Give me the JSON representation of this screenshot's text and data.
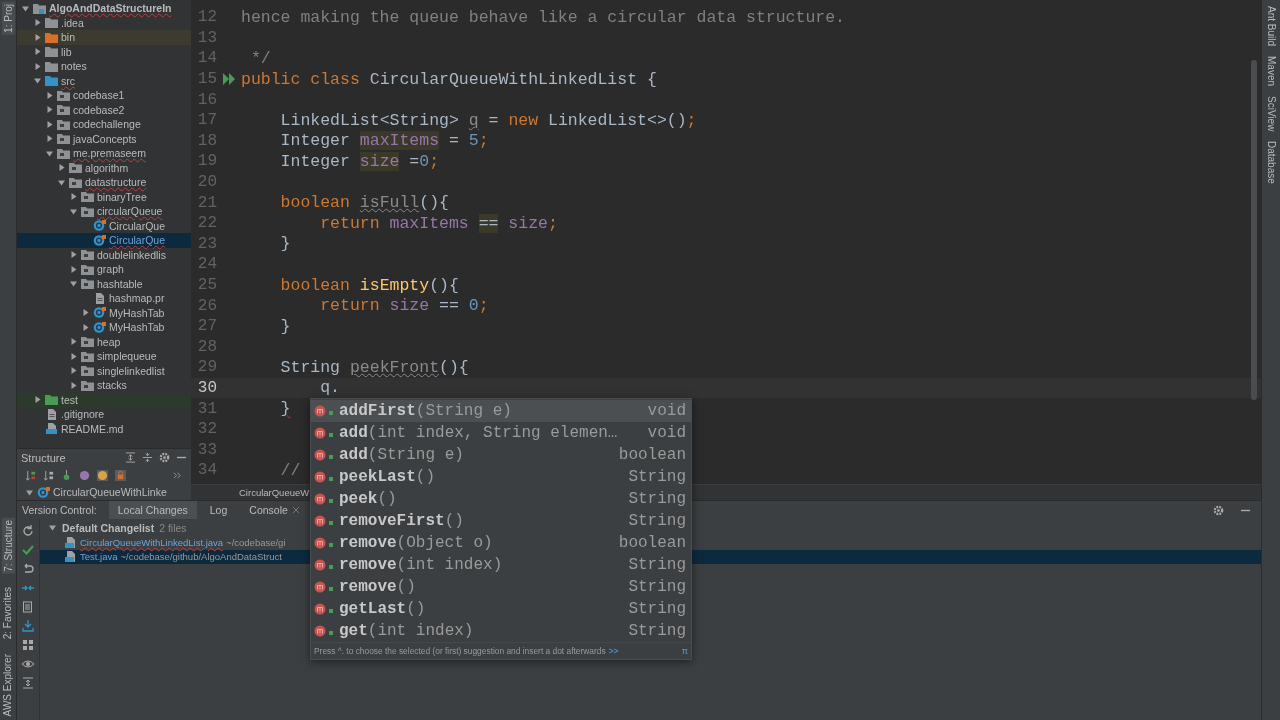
{
  "left_strip": {
    "top_tab": {
      "label": "1: Proj",
      "selected": true
    },
    "bottom_tabs": [
      {
        "label": "7: Structure",
        "selected": true
      },
      {
        "label": "2: Favorites",
        "selected": false
      },
      {
        "label": "AWS Explorer",
        "selected": false
      }
    ]
  },
  "project_tree": {
    "items": [
      {
        "label": "AlgoAndDataStructureIn",
        "kind": "project",
        "expanded": true,
        "selected": false,
        "errors": true,
        "children": [
          {
            "label": ".idea",
            "kind": "folder",
            "expanded": false,
            "selected": false,
            "errors": false
          },
          {
            "label": "bin",
            "kind": "folder_excluded",
            "expanded": false,
            "selected": false,
            "errors": false
          },
          {
            "label": "lib",
            "kind": "folder",
            "expanded": false,
            "selected": false,
            "errors": false
          },
          {
            "label": "notes",
            "kind": "folder",
            "expanded": false,
            "selected": false,
            "errors": false
          },
          {
            "label": "src",
            "kind": "folder_source",
            "expanded": true,
            "selected": false,
            "errors": true,
            "children": [
              {
                "label": "codebase1",
                "kind": "package",
                "expanded": false,
                "selected": false,
                "errors": false
              },
              {
                "label": "codebase2",
                "kind": "package",
                "expanded": false,
                "selected": false,
                "errors": false
              },
              {
                "label": "codechallenge",
                "kind": "package",
                "expanded": false,
                "selected": false,
                "errors": false
              },
              {
                "label": "javaConcepts",
                "kind": "package",
                "expanded": false,
                "selected": false,
                "errors": false
              },
              {
                "label": "me.premaseem",
                "kind": "package",
                "expanded": true,
                "selected": false,
                "errors": true,
                "children": [
                  {
                    "label": "algorithm",
                    "kind": "package",
                    "expanded": false,
                    "selected": false,
                    "errors": false
                  },
                  {
                    "label": "datastructure",
                    "kind": "package",
                    "expanded": true,
                    "selected": false,
                    "errors": true,
                    "children": [
                      {
                        "label": "binaryTree",
                        "kind": "package",
                        "expanded": false,
                        "selected": false,
                        "errors": false
                      },
                      {
                        "label": "circularQueue",
                        "kind": "package",
                        "expanded": true,
                        "selected": false,
                        "errors": true,
                        "children": [
                          {
                            "label": "CircularQue",
                            "kind": "class",
                            "selected": false,
                            "errors": false
                          },
                          {
                            "label": "CircularQue",
                            "kind": "class",
                            "selected": true,
                            "errors": true
                          }
                        ]
                      },
                      {
                        "label": "doublelinkedlis",
                        "kind": "package",
                        "expanded": false,
                        "selected": false,
                        "errors": false
                      },
                      {
                        "label": "graph",
                        "kind": "package",
                        "expanded": false,
                        "selected": false,
                        "errors": false
                      },
                      {
                        "label": "hashtable",
                        "kind": "package",
                        "expanded": true,
                        "selected": false,
                        "errors": false,
                        "children": [
                          {
                            "label": "hashmap.pr",
                            "kind": "file",
                            "selected": false,
                            "errors": false
                          },
                          {
                            "label": "MyHashTab",
                            "kind": "class",
                            "expanded": false,
                            "selected": false,
                            "errors": false
                          },
                          {
                            "label": "MyHashTab",
                            "kind": "class",
                            "expanded": false,
                            "selected": false,
                            "errors": false
                          }
                        ]
                      },
                      {
                        "label": "heap",
                        "kind": "package",
                        "expanded": false,
                        "selected": false,
                        "errors": false
                      },
                      {
                        "label": "simplequeue",
                        "kind": "package",
                        "expanded": false,
                        "selected": false,
                        "errors": false
                      },
                      {
                        "label": "singlelinkedlist",
                        "kind": "package",
                        "expanded": false,
                        "selected": false,
                        "errors": false
                      },
                      {
                        "label": "stacks",
                        "kind": "package",
                        "expanded": false,
                        "selected": false,
                        "errors": false
                      }
                    ]
                  }
                ]
              }
            ]
          },
          {
            "label": "test",
            "kind": "folder_test",
            "expanded": false,
            "selected": false,
            "errors": false
          },
          {
            "label": ".gitignore",
            "kind": "file",
            "selected": false,
            "errors": false
          },
          {
            "label": "README.md",
            "kind": "file_md",
            "selected": false,
            "errors": false
          }
        ]
      }
    ]
  },
  "structure_panel": {
    "title": "Structure",
    "node": {
      "label": "CircularQueueWithLinke",
      "expanded": true
    }
  },
  "editor": {
    "lines": [
      {
        "number": "12",
        "current": false,
        "segments": [
          {
            "text": "hence making the queue behave like a circular data structure.",
            "kind": "comment"
          }
        ]
      },
      {
        "number": "13",
        "current": false
      },
      {
        "number": "14",
        "current": false,
        "segments": [
          {
            "text": " */",
            "kind": "comment"
          }
        ]
      },
      {
        "number": "15",
        "current": false,
        "run_gutter": true,
        "segments": [
          {
            "text": "public class ",
            "kind": "keyword"
          },
          {
            "text": "CircularQueueWithLinkedList {",
            "kind": "plain"
          }
        ]
      },
      {
        "number": "16",
        "current": false
      },
      {
        "number": "17",
        "current": false,
        "segments": [
          {
            "text": "    LinkedList<String> ",
            "kind": "plain"
          },
          {
            "text": "q",
            "kind": "unused"
          },
          {
            "text": " = ",
            "kind": "plain"
          },
          {
            "text": "new ",
            "kind": "keyword"
          },
          {
            "text": "LinkedList<>()",
            "kind": "plain"
          },
          {
            "text": ";",
            "kind": "keyword"
          }
        ]
      },
      {
        "number": "18",
        "current": false,
        "segments": [
          {
            "text": "    Integer ",
            "kind": "plain"
          },
          {
            "text": "maxItems",
            "kind": "field_marked"
          },
          {
            "text": " = ",
            "kind": "plain"
          },
          {
            "text": "5",
            "kind": "number"
          },
          {
            "text": ";",
            "kind": "keyword"
          }
        ]
      },
      {
        "number": "19",
        "current": false,
        "segments": [
          {
            "text": "    Integer ",
            "kind": "plain"
          },
          {
            "text": "size",
            "kind": "field_marked"
          },
          {
            "text": " =",
            "kind": "plain"
          },
          {
            "text": "0",
            "kind": "number"
          },
          {
            "text": ";",
            "kind": "keyword"
          }
        ]
      },
      {
        "number": "20",
        "current": false
      },
      {
        "number": "21",
        "current": false,
        "segments": [
          {
            "text": "    boolean ",
            "kind": "keyword"
          },
          {
            "text": "isFull",
            "kind": "unused"
          },
          {
            "text": "(){",
            "kind": "plain"
          }
        ]
      },
      {
        "number": "22",
        "current": false,
        "segments": [
          {
            "text": "        return ",
            "kind": "keyword"
          },
          {
            "text": "maxItems ",
            "kind": "field"
          },
          {
            "text": "==",
            "kind": "marked"
          },
          {
            "text": " size",
            "kind": "field"
          },
          {
            "text": ";",
            "kind": "keyword"
          }
        ]
      },
      {
        "number": "23",
        "current": false,
        "segments": [
          {
            "text": "    }",
            "kind": "plain"
          }
        ]
      },
      {
        "number": "24",
        "current": false
      },
      {
        "number": "25",
        "current": false,
        "segments": [
          {
            "text": "    boolean ",
            "kind": "keyword"
          },
          {
            "text": "isEmpty",
            "kind": "method"
          },
          {
            "text": "(){",
            "kind": "plain"
          }
        ]
      },
      {
        "number": "26",
        "current": false,
        "segments": [
          {
            "text": "        return ",
            "kind": "keyword"
          },
          {
            "text": "size ",
            "kind": "field"
          },
          {
            "text": "== ",
            "kind": "plain"
          },
          {
            "text": "0",
            "kind": "number"
          },
          {
            "text": ";",
            "kind": "keyword"
          }
        ]
      },
      {
        "number": "27",
        "current": false,
        "segments": [
          {
            "text": "    }",
            "kind": "plain"
          }
        ]
      },
      {
        "number": "28",
        "current": false
      },
      {
        "number": "29",
        "current": false,
        "segments": [
          {
            "text": "    String ",
            "kind": "plain"
          },
          {
            "text": "peekFront",
            "kind": "unused"
          },
          {
            "text": "(){",
            "kind": "plain"
          }
        ]
      },
      {
        "number": "30",
        "current": true,
        "segments": [
          {
            "text": "        q.",
            "kind": "plain"
          }
        ]
      },
      {
        "number": "31",
        "current": false,
        "segments": [
          {
            "text": "    }",
            "kind": "error"
          }
        ]
      },
      {
        "number": "32",
        "current": false
      },
      {
        "number": "33",
        "current": false
      },
      {
        "number": "34",
        "current": false,
        "segments": [
          {
            "text": "    //",
            "kind": "comment"
          }
        ]
      }
    ],
    "breadcrumb": "CircularQueueW"
  },
  "completion_popup": {
    "items": [
      {
        "name": "addFirst",
        "params": "(String e)",
        "type": "void",
        "selected": true
      },
      {
        "name": "add",
        "params": "(int index, String elemen…",
        "type": "void",
        "selected": false
      },
      {
        "name": "add",
        "params": "(String e)",
        "type": "boolean",
        "selected": false
      },
      {
        "name": "peekLast",
        "params": "()",
        "type": "String",
        "selected": false
      },
      {
        "name": "peek",
        "params": "()",
        "type": "String",
        "selected": false
      },
      {
        "name": "removeFirst",
        "params": "()",
        "type": "String",
        "selected": false
      },
      {
        "name": "remove",
        "params": "(Object o)",
        "type": "boolean",
        "selected": false
      },
      {
        "name": "remove",
        "params": "(int index)",
        "type": "String",
        "selected": false
      },
      {
        "name": "remove",
        "params": "()",
        "type": "String",
        "selected": false
      },
      {
        "name": "getLast",
        "params": "()",
        "type": "String",
        "selected": false
      },
      {
        "name": "get",
        "params": "(int index)",
        "type": "String",
        "selected": false
      }
    ],
    "hint": "Press ^. to choose the selected (or first) suggestion and insert a dot afterwards",
    "hint_link": ">>",
    "pin_glyph": "π"
  },
  "version_control": {
    "label": "Version Control:",
    "tabs": [
      {
        "label": "Local Changes",
        "selected": true,
        "closable": false
      },
      {
        "label": "Log",
        "selected": false,
        "closable": false
      },
      {
        "label": "Console",
        "selected": false,
        "closable": true
      }
    ],
    "changelist": {
      "name": "Default Changelist",
      "count": "2 files",
      "expanded": true,
      "files": [
        {
          "name": "CircularQueueWithLinkedList.java",
          "path": "~/codebase/gi",
          "selected": false,
          "errors": true
        },
        {
          "name": "Test.java",
          "path": "~/codebase/github/AlgoAndDataStruct",
          "selected": true,
          "errors": false
        }
      ]
    }
  },
  "right_strip": {
    "tabs": [
      "Ant Build",
      "Maven",
      "SciView",
      "Database"
    ]
  }
}
